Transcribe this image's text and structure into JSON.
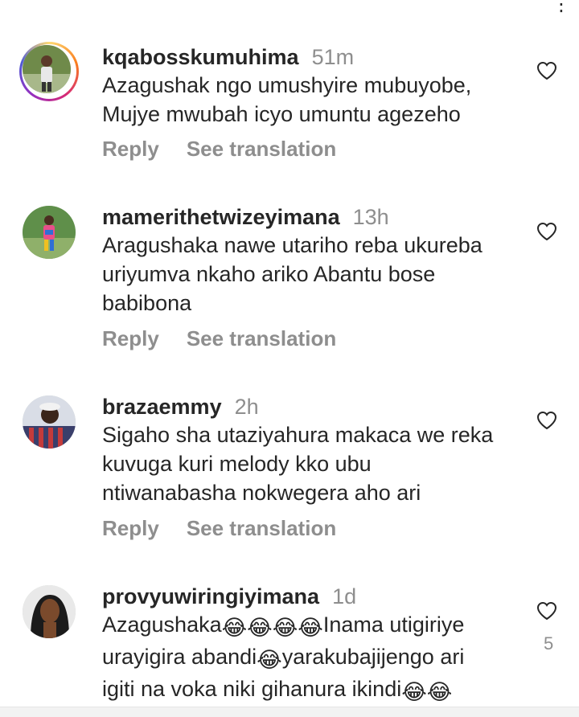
{
  "comments": [
    {
      "username": "kqabosskumuhima",
      "time": "51m",
      "lines": [
        "Azagushak ngo umushyire mubuyobe,",
        "Mujye mwubah icyo umuntu agezeho"
      ],
      "reply_label": "Reply",
      "translate_label": "See translation",
      "avatar_icon": "user-avatar",
      "story_ring": true
    },
    {
      "username": "mamerithetwizeyimana",
      "time": "13h",
      "lines": [
        "Aragushaka nawe utariho reba ukureba",
        "uriyumva nkaho ariko Abantu bose",
        "babibona"
      ],
      "reply_label": "Reply",
      "translate_label": "See translation",
      "avatar_icon": "user-avatar"
    },
    {
      "username": "brazaemmy",
      "time": "2h",
      "lines": [
        "Sigaho sha utaziyahura makaca we reka",
        "kuvuga kuri melody kko ubu",
        "ntiwanabasha nokwegera aho ari"
      ],
      "reply_label": "Reply",
      "translate_label": "See translation",
      "avatar_icon": "user-avatar"
    },
    {
      "username": "provyuwiringiyimana",
      "time": "1d",
      "line1_a": "Azagushaka",
      "line1_b": "Inama utigiriye",
      "line2_a": "urayigira abandi",
      "line2_b": "yarakubajijengo ari",
      "line3_a": "igiti na voka niki gihanura ikindi",
      "emoji": "😂",
      "like_count": "5",
      "avatar_icon": "user-avatar"
    }
  ],
  "icons": {
    "like": "heart-outline-icon",
    "more": "more-dots-icon"
  },
  "colors": {
    "text": "#262626",
    "muted": "#8e8e8e",
    "story_ring": [
      "#feda75",
      "#fa7e1e",
      "#d62976",
      "#962fbf",
      "#4f5bd5"
    ]
  }
}
